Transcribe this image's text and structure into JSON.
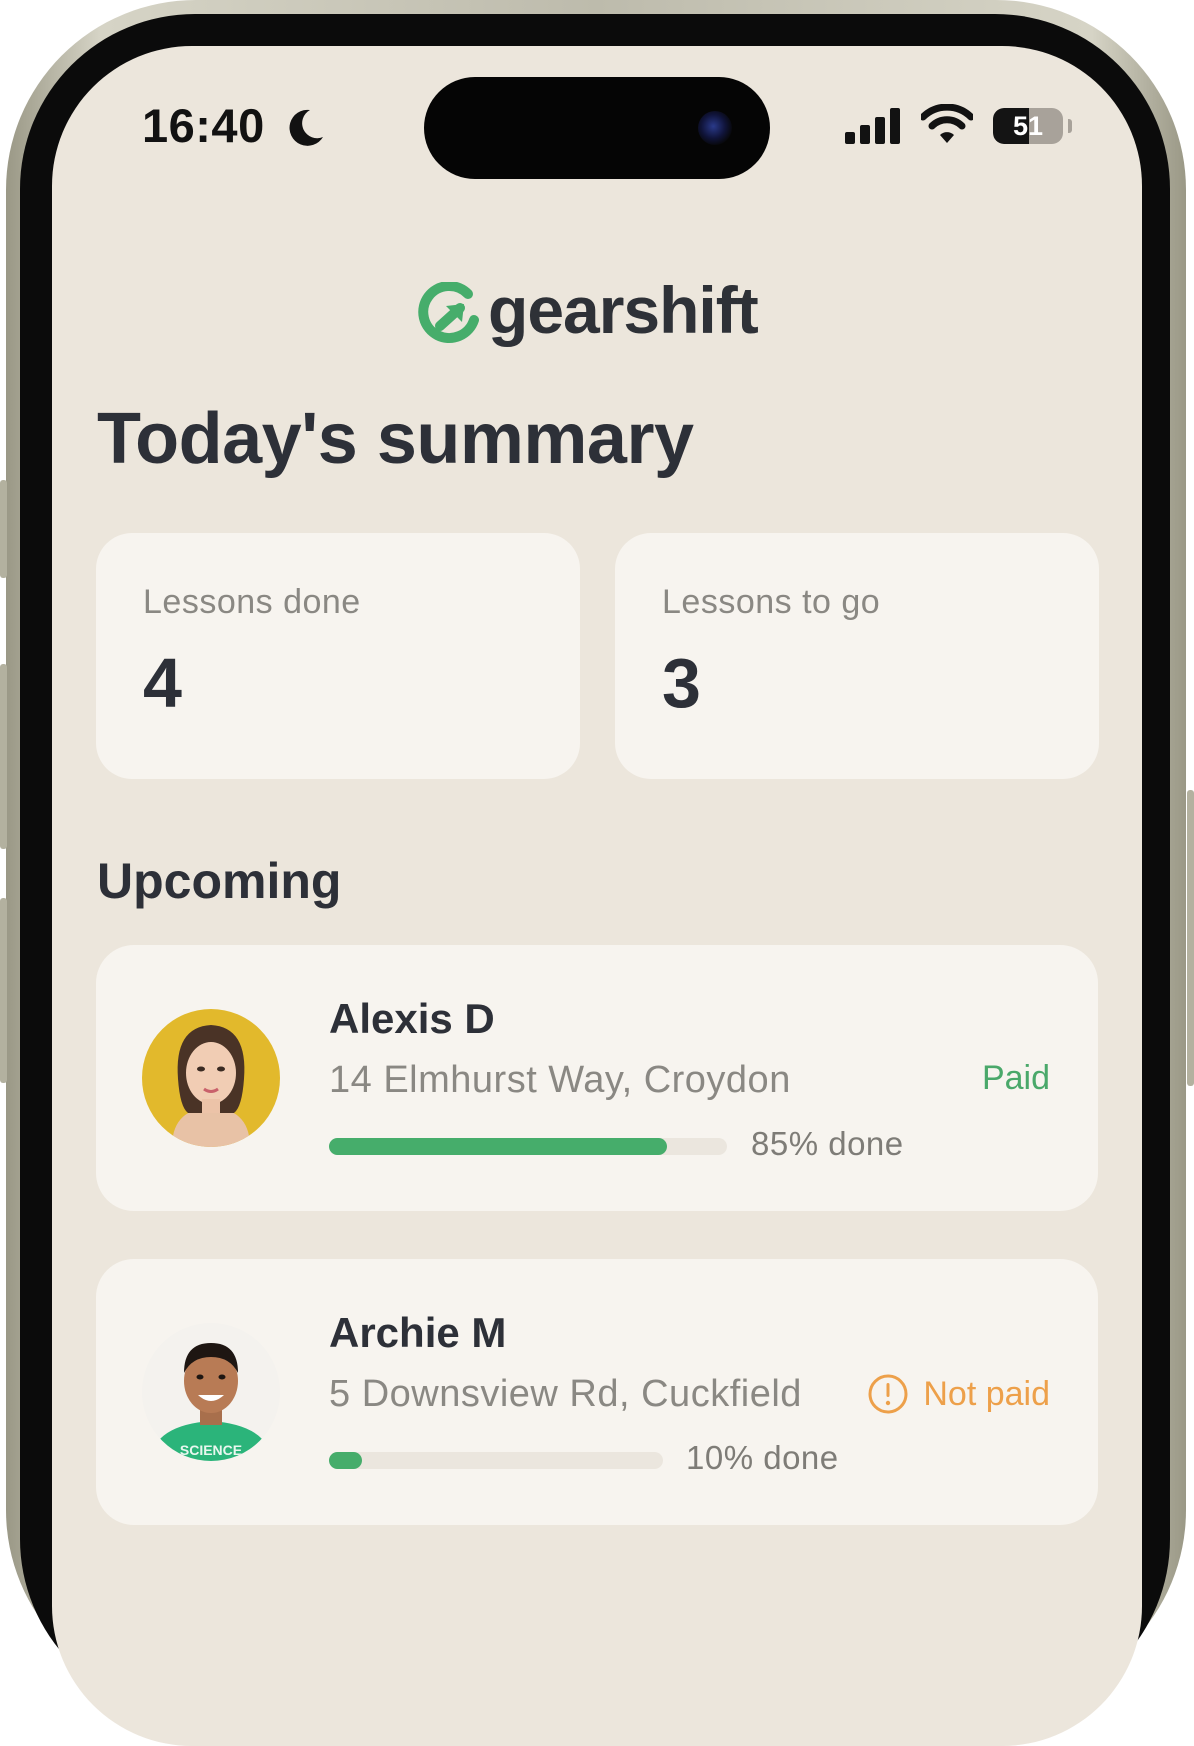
{
  "status_bar": {
    "time": "16:40",
    "focus_icon": "moon-icon",
    "signal_icon": "cellular-signal-icon",
    "wifi_icon": "wifi-icon",
    "battery_level": "51",
    "battery_fraction": 0.51
  },
  "brand": {
    "name": "gearshift",
    "logo_icon": "gearshift-logo-icon",
    "accent_color": "#46ad6b"
  },
  "summary": {
    "title": "Today's summary",
    "stats": [
      {
        "label": "Lessons done",
        "value": "4"
      },
      {
        "label": "Lessons to go",
        "value": "3"
      }
    ]
  },
  "upcoming": {
    "title": "Upcoming",
    "lessons": [
      {
        "name": "Alexis D",
        "address": "14 Elmhurst Way, Croydon",
        "progress_label": "85% done",
        "progress": 0.85,
        "payment_status": "Paid",
        "payment_color": "#4aa86a"
      },
      {
        "name": "Archie M",
        "address": "5 Downsview Rd, Cuckfield",
        "progress_label": "10% done",
        "progress": 0.1,
        "payment_status": "Not paid",
        "payment_icon": "warning-circle-icon",
        "payment_color": "#eda04a"
      }
    ]
  }
}
